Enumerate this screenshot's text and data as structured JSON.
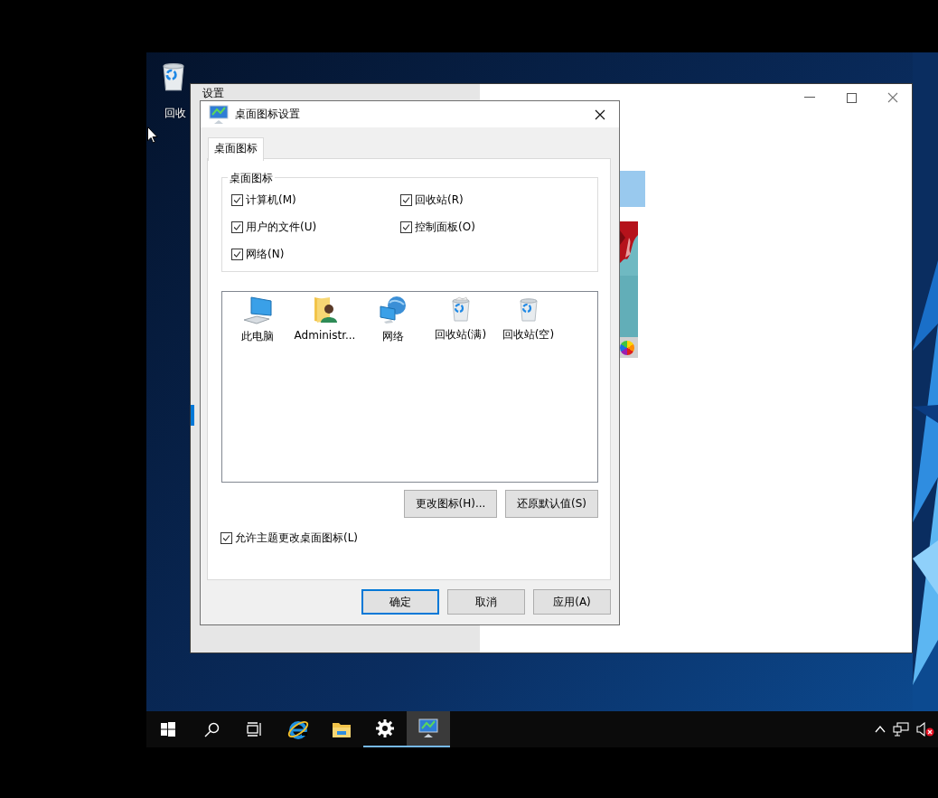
{
  "desktop": {
    "icons": [
      {
        "label": "回收"
      }
    ]
  },
  "settings_window": {
    "title": "设置"
  },
  "dialog": {
    "title": "桌面图标设置",
    "tabs": [
      {
        "label": "桌面图标",
        "selected": true
      }
    ],
    "group": {
      "title": "桌面图标",
      "options": [
        {
          "label": "计算机(M)",
          "checked": true
        },
        {
          "label": "回收站(R)",
          "checked": true
        },
        {
          "label": "用户的文件(U)",
          "checked": true
        },
        {
          "label": "控制面板(O)",
          "checked": true
        },
        {
          "label": "网络(N)",
          "checked": true
        }
      ]
    },
    "icons": [
      {
        "label": "此电脑",
        "kind": "computer"
      },
      {
        "label": "Administr...",
        "kind": "user-folder"
      },
      {
        "label": "网络",
        "kind": "network"
      },
      {
        "label": "回收站(满)",
        "kind": "recycle-full"
      },
      {
        "label": "回收站(空)",
        "kind": "recycle-empty"
      }
    ],
    "actions": [
      "更改图标(H)...",
      "还原默认值(S)"
    ],
    "allow_theme": {
      "label": "允许主题更改桌面图标(L)",
      "checked": true
    },
    "buttons": [
      {
        "label": "确定",
        "default": true
      },
      {
        "label": "取消",
        "default": false
      },
      {
        "label": "应用(A)",
        "default": false
      }
    ]
  },
  "taskbar": {
    "apps": [
      {
        "kind": "start",
        "running": false,
        "active": false
      },
      {
        "kind": "search",
        "running": false,
        "active": false
      },
      {
        "kind": "task-view",
        "running": false,
        "active": false
      },
      {
        "kind": "browser",
        "running": false,
        "active": false
      },
      {
        "kind": "explorer",
        "running": false,
        "active": false
      },
      {
        "kind": "settings",
        "running": true,
        "active": false
      },
      {
        "kind": "desktop-icons",
        "running": true,
        "active": true
      }
    ],
    "volume_muted": true
  }
}
